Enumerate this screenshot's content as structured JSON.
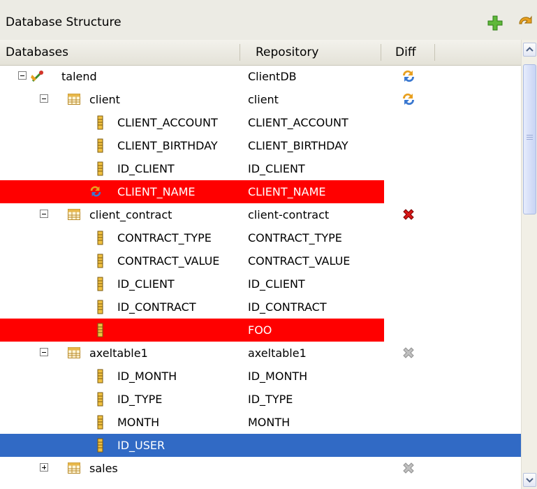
{
  "panel": {
    "title": "Database Structure"
  },
  "toolbar": {
    "add_icon": "plus-icon",
    "sync_icon": "sync-icon"
  },
  "columns": {
    "databases": "Databases",
    "repository": "Repository",
    "diff": "Diff"
  },
  "colors": {
    "error_row": "#ff0000",
    "selected_row": "#316ac5",
    "header_bg": "#ecebe4"
  },
  "rows": [
    {
      "label": "talend",
      "repository": "ClientDB",
      "kind": "database",
      "level": 0,
      "toggle": "minus",
      "diff": "sync",
      "state": "normal"
    },
    {
      "label": "client",
      "repository": "client",
      "kind": "table",
      "level": 1,
      "toggle": "minus",
      "diff": "sync",
      "state": "normal"
    },
    {
      "label": "CLIENT_ACCOUNT",
      "repository": "CLIENT_ACCOUNT",
      "kind": "column",
      "level": 2,
      "state": "normal"
    },
    {
      "label": "CLIENT_BIRTHDAY",
      "repository": "CLIENT_BIRTHDAY",
      "kind": "column",
      "level": 2,
      "state": "normal"
    },
    {
      "label": "ID_CLIENT",
      "repository": "ID_CLIENT",
      "kind": "column",
      "level": 2,
      "state": "normal"
    },
    {
      "label": "CLIENT_NAME",
      "repository": "CLIENT_NAME",
      "kind": "column-sync",
      "level": 2,
      "state": "error"
    },
    {
      "label": "client_contract",
      "repository": "client-contract",
      "kind": "table",
      "level": 1,
      "toggle": "minus",
      "diff": "delete-red",
      "state": "normal"
    },
    {
      "label": "CONTRACT_TYPE",
      "repository": "CONTRACT_TYPE",
      "kind": "column",
      "level": 2,
      "state": "normal"
    },
    {
      "label": "CONTRACT_VALUE",
      "repository": "CONTRACT_VALUE",
      "kind": "column",
      "level": 2,
      "state": "normal"
    },
    {
      "label": "ID_CLIENT",
      "repository": "ID_CLIENT",
      "kind": "column",
      "level": 2,
      "state": "normal"
    },
    {
      "label": "ID_CONTRACT",
      "repository": "ID_CONTRACT",
      "kind": "column",
      "level": 2,
      "state": "normal"
    },
    {
      "label": "",
      "repository": "FOO",
      "kind": "column",
      "level": 2,
      "state": "error"
    },
    {
      "label": "axeltable1",
      "repository": "axeltable1",
      "kind": "table",
      "level": 1,
      "toggle": "minus",
      "diff": "delete-gray",
      "state": "normal"
    },
    {
      "label": "ID_MONTH",
      "repository": "ID_MONTH",
      "kind": "column",
      "level": 2,
      "state": "normal"
    },
    {
      "label": "ID_TYPE",
      "repository": "ID_TYPE",
      "kind": "column",
      "level": 2,
      "state": "normal"
    },
    {
      "label": "MONTH",
      "repository": "MONTH",
      "kind": "column",
      "level": 2,
      "state": "normal"
    },
    {
      "label": "ID_USER",
      "repository": "",
      "kind": "column",
      "level": 2,
      "state": "selected"
    },
    {
      "label": "sales",
      "repository": "",
      "kind": "table",
      "level": 1,
      "toggle": "plus",
      "diff": "delete-gray",
      "state": "normal"
    }
  ]
}
